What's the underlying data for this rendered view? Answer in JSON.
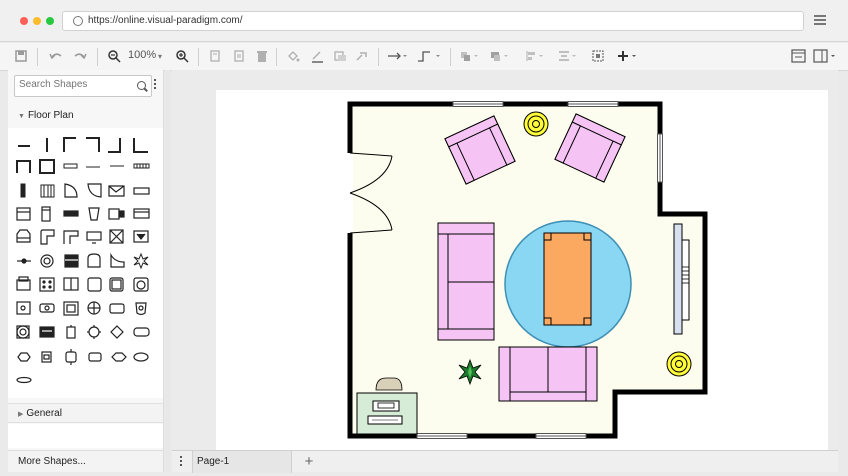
{
  "browser": {
    "url": "https://online.visual-paradigm.com/"
  },
  "toolbar": {
    "zoom_label": "100%",
    "icons": [
      "save-icon",
      "undo-icon",
      "redo-icon",
      "zoom-out-icon",
      "zoom-in-icon",
      "copy-icon",
      "paste-icon",
      "delete-icon",
      "fill-icon",
      "line-color-icon",
      "shadow-icon",
      "format-painter-icon",
      "connector-icon",
      "waypoint-icon",
      "to-front-icon",
      "to-back-icon",
      "align-icon",
      "distribute-icon",
      "group-icon",
      "add-icon",
      "panel-icon",
      "layout-icon"
    ]
  },
  "sidebar": {
    "search_placeholder": "Search Shapes",
    "sections": [
      {
        "label": "Floor Plan",
        "expanded": true
      },
      {
        "label": "General",
        "expanded": false
      }
    ],
    "more_shapes_label": "More Shapes..."
  },
  "pages": {
    "tabs": [
      {
        "label": "Page-1"
      }
    ],
    "add_label": "+"
  },
  "colors": {
    "floor": "#fdfdef",
    "wall": "#000000",
    "armchair": "#f5c4f5",
    "sofa": "#f5c4f5",
    "rug": "#89d7f3",
    "coffee_table": "#fba861",
    "lamp": "#fffc3a",
    "plant": "#1e7a2c",
    "desk": "#d6ecd6"
  }
}
